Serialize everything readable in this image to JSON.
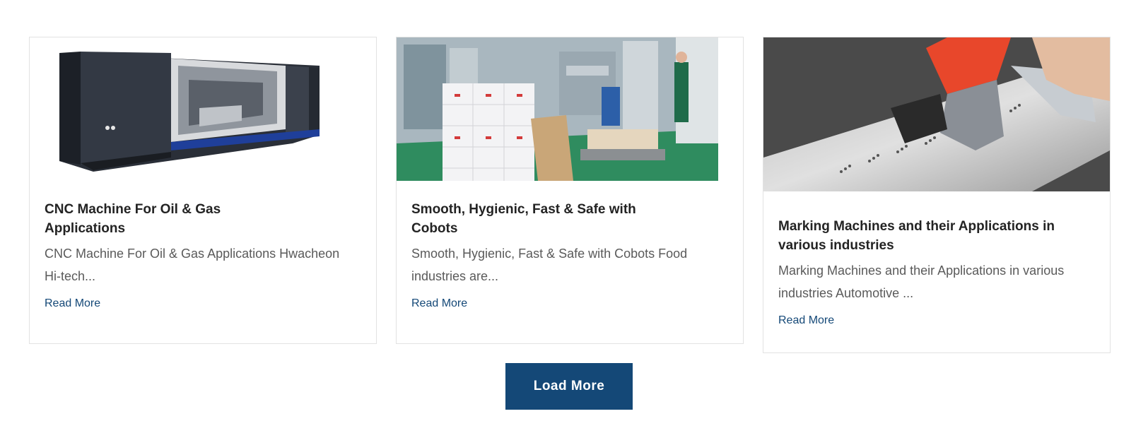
{
  "posts": [
    {
      "title_line1": "CNC Machine For Oil & Gas",
      "title_line2": "Applications",
      "excerpt_line1": "CNC Machine For Oil & Gas Applications Hwacheon",
      "excerpt_line2": "Hi-tech...",
      "read_more": "Read More",
      "image": "cnc-machine-image"
    },
    {
      "title_line1": "Smooth, Hygienic, Fast & Safe with",
      "title_line2": "Cobots",
      "excerpt_line1": "Smooth, Hygienic, Fast & Safe with Cobots Food",
      "excerpt_line2": "industries are...",
      "read_more": "Read More",
      "image": "factory-cobots-image"
    },
    {
      "title_line1": "Marking Machines and their Applications in",
      "title_line2": "various industries",
      "excerpt_line1": "Marking Machines and their Applications in various",
      "excerpt_line2": "industries Automotive ...",
      "read_more": "Read More",
      "image": "marking-machine-image"
    }
  ],
  "load_more_label": "Load More",
  "colors": {
    "accent": "#144877",
    "title": "#232323",
    "excerpt": "#5a5a5a",
    "border": "#e2e2e2"
  }
}
